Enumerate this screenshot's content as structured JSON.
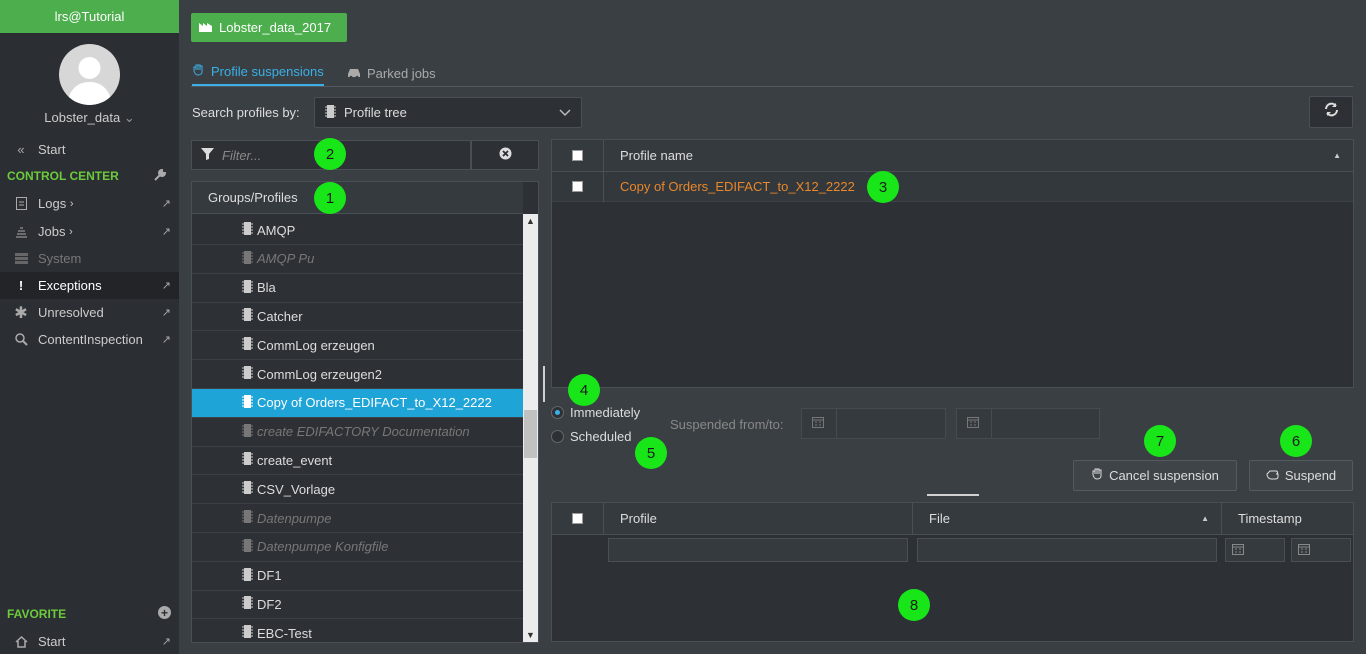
{
  "user": {
    "name": "lrs@Tutorial"
  },
  "client": {
    "name": "Lobster_data"
  },
  "sidebar": {
    "start_label": "Start",
    "control_center_label": "CONTROL CENTER",
    "items": [
      {
        "label": "Logs",
        "icon": "document-icon"
      },
      {
        "label": "Jobs",
        "icon": "jobs-icon"
      },
      {
        "label": "System",
        "icon": "system-icon"
      },
      {
        "label": "Exceptions",
        "icon": "exclamation-icon"
      },
      {
        "label": "Unresolved",
        "icon": "asterisk-icon"
      },
      {
        "label": "ContentInspection",
        "icon": "magnifier-icon"
      }
    ],
    "favorite_label": "FAVORITE",
    "favorite_items": [
      {
        "label": "Start",
        "icon": "home-icon"
      }
    ]
  },
  "project": {
    "label": "Lobster_data_2017"
  },
  "tabs": [
    {
      "label": "Profile suspensions"
    },
    {
      "label": "Parked jobs"
    }
  ],
  "search": {
    "label": "Search profiles by:",
    "selected": "Profile tree",
    "filter_placeholder": "Filter..."
  },
  "tree": {
    "header": "Groups/Profiles",
    "rows": [
      {
        "label": "AMQP"
      },
      {
        "label": "AMQP Pu"
      },
      {
        "label": "Bla"
      },
      {
        "label": "Catcher"
      },
      {
        "label": "CommLog erzeugen"
      },
      {
        "label": "CommLog erzeugen2"
      },
      {
        "label": "Copy of Orders_EDIFACT_to_X12_2222"
      },
      {
        "label": "create EDIFACTORY Documentation"
      },
      {
        "label": "create_event"
      },
      {
        "label": "CSV_Vorlage"
      },
      {
        "label": "Datenpumpe"
      },
      {
        "label": "Datenpumpe Konfigfile"
      },
      {
        "label": "DF1"
      },
      {
        "label": "DF2"
      },
      {
        "label": "EBC-Test"
      }
    ]
  },
  "profile_grid": {
    "header": "Profile name",
    "rows": [
      {
        "name": "Copy of Orders_EDIFACT_to_X12_2222"
      }
    ]
  },
  "timing": {
    "immediately_label": "Immediately",
    "scheduled_label": "Scheduled",
    "selected": "Immediately",
    "suspended_label": "Suspended from/to:"
  },
  "actions": {
    "cancel_label": "Cancel suspension",
    "suspend_label": "Suspend"
  },
  "jobs_grid": {
    "columns": [
      "Profile",
      "File",
      "Timestamp"
    ]
  },
  "badges": [
    "1",
    "2",
    "3",
    "4",
    "5",
    "6",
    "7",
    "8"
  ],
  "colors": {
    "accent_green": "#4cae4c",
    "selection_blue": "#1fa4d8",
    "link_orange": "#e8872b",
    "badge_green": "#19e619"
  }
}
